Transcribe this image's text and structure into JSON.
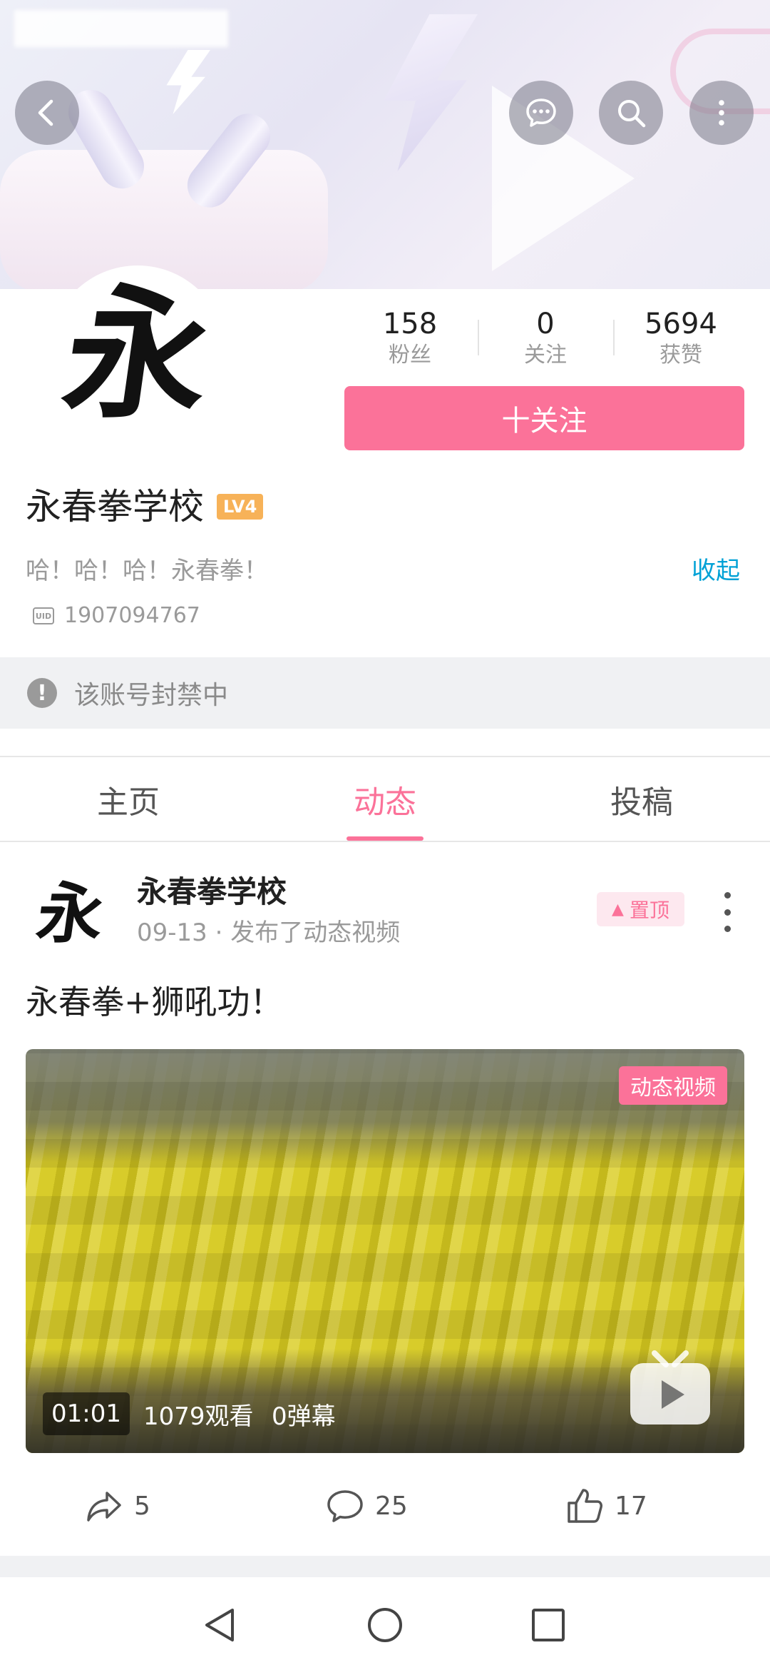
{
  "header": {
    "icons": [
      "back-arrow-icon",
      "message-icon",
      "search-icon",
      "more-vert-icon"
    ]
  },
  "profile": {
    "avatar_char": "永",
    "stats": [
      {
        "value": "158",
        "label": "粉丝"
      },
      {
        "value": "0",
        "label": "关注"
      },
      {
        "value": "5694",
        "label": "获赞"
      }
    ],
    "follow_label": "十关注",
    "username": "永春拳学校",
    "level_badge": "LV4",
    "bio": "哈！哈！哈！永春拳！",
    "collapse_label": "收起",
    "uid_icon_text": "UID",
    "uid": "1907094767",
    "ban_notice": "该账号封禁中"
  },
  "tabs": [
    {
      "label": "主页",
      "active": false
    },
    {
      "label": "动态",
      "active": true
    },
    {
      "label": "投稿",
      "active": false
    }
  ],
  "post": {
    "avatar_char": "永",
    "author": "永春拳学校",
    "meta": "09-13 · 发布了动态视频",
    "pin_label": "置顶",
    "text": "永春拳+狮吼功！",
    "video": {
      "badge": "动态视频",
      "duration": "01:01",
      "views": "1079观看",
      "danmaku": "0弹幕"
    },
    "actions": {
      "share_count": "5",
      "comment_count": "25",
      "like_count": "17"
    }
  },
  "colors": {
    "accent_pink": "#fb7299",
    "link_blue": "#00a1d6",
    "level_orange": "#f7b258"
  }
}
